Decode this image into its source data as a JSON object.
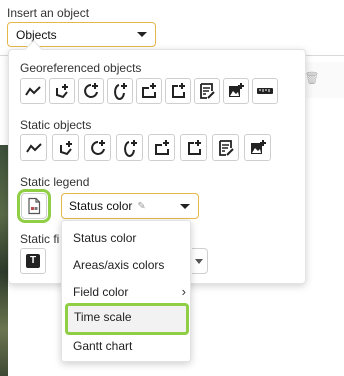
{
  "insert": {
    "label": "Insert an object",
    "select_value": "Objects"
  },
  "panel": {
    "geo_title": "Georeferenced objects",
    "static_title": "Static objects",
    "legend_title": "Static legend",
    "field_title": "Static fi"
  },
  "geo_icons": [
    "polyline-icon",
    "polygon-plus-icon",
    "circle-plus-icon",
    "ellipse-plus-icon",
    "rectangle-plus-icon",
    "square-plus-icon",
    "text-note-icon",
    "image-plus-icon",
    "ruler-icon"
  ],
  "static_icons": [
    "polyline-icon",
    "polygon-plus-icon",
    "circle-plus-icon",
    "ellipse-plus-icon",
    "rectangle-plus-icon",
    "square-plus-icon",
    "text-note-icon",
    "image-plus-icon"
  ],
  "legend": {
    "select_value": "Status color"
  },
  "menu": {
    "items": [
      {
        "label": "Status color"
      },
      {
        "label": "Areas/axis colors"
      },
      {
        "label": "Field color",
        "submenu": "›"
      },
      {
        "label": "Time scale"
      },
      {
        "label": "Gantt chart"
      }
    ]
  },
  "colors": {
    "highlight": "#8fce45",
    "focus_border": "#e6b84c"
  }
}
